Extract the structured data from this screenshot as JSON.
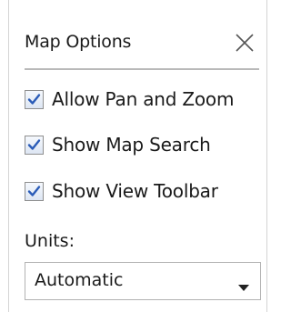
{
  "panel": {
    "title": "Map Options",
    "close_icon": "close-icon"
  },
  "options": [
    {
      "label": "Allow Pan and Zoom",
      "checked": true
    },
    {
      "label": "Show Map Search",
      "checked": true
    },
    {
      "label": "Show View Toolbar",
      "checked": true
    }
  ],
  "units": {
    "label": "Units:",
    "selected": "Automatic"
  },
  "colors": {
    "check": "#2b5cb8",
    "divider": "#b9b9b9"
  }
}
